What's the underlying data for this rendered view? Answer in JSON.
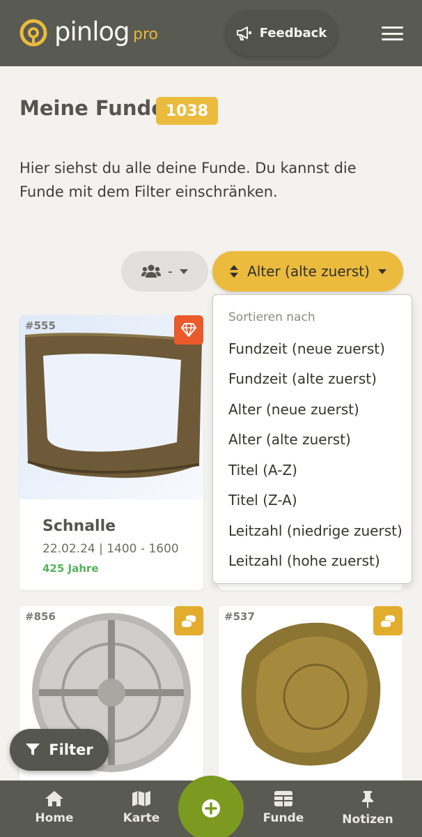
{
  "header": {
    "logo_text": "pinlog",
    "logo_suffix": "pro",
    "feedback_label": "Feedback"
  },
  "page": {
    "title": "Meine Funde",
    "count": "1038",
    "description": "Hier siehst du alle deine Funde. Du kannst die Funde mit dem Filter einschränken."
  },
  "controls": {
    "group_value": "-",
    "sort_label": "Alter (alte zuerst)"
  },
  "sort_menu": {
    "header": "Sortieren nach",
    "items": [
      "Fundzeit (neue zuerst)",
      "Fundzeit (alte zuerst)",
      "Alter (neue zuerst)",
      "Alter (alte zuerst)",
      "Titel (A-Z)",
      "Titel (Z-A)",
      "Leitzahl (niedrige zuerst)",
      "Leitzahl (hohe zuerst)"
    ]
  },
  "cards": [
    {
      "id": "#555",
      "title": "Schnalle",
      "meta": "22.02.24 | 1400 - 1600",
      "age": "425 Jahre",
      "badge_icon": "gem-icon",
      "badge_color": "#ea5a2a"
    },
    {
      "id": "#856",
      "badge_icon": "coins-icon",
      "badge_color": "#e2ad2c"
    },
    {
      "id": "#537",
      "badge_icon": "coins-icon",
      "badge_color": "#e2ad2c"
    }
  ],
  "filter_label": "Filter",
  "nav": {
    "home": "Home",
    "karte": "Karte",
    "funde": "Funde",
    "notizen": "Notizen"
  },
  "colors": {
    "header_bg": "#595a52",
    "accent": "#ebbb3e",
    "age_green": "#55b35b",
    "add_button": "#7b9a1f"
  }
}
